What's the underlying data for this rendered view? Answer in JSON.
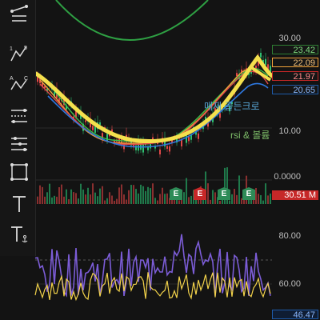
{
  "price_axis": {
    "top": "30.00",
    "mid": "10.00",
    "vol_zero": "0.0000"
  },
  "price_tags": [
    {
      "value": "23.42",
      "color": "#2e7d32",
      "text_color": "#7fdc7f"
    },
    {
      "value": "22.09",
      "color": "#f2a33a",
      "text_color": "#f2c07a"
    },
    {
      "value": "21.97",
      "color": "#c62828",
      "text_color": "#ff8a8a"
    },
    {
      "value": "20.65",
      "color": "#1e5aa8",
      "text_color": "#8ab8ff"
    }
  ],
  "volume_tag": {
    "value": "30.51 M",
    "color": "#c62828"
  },
  "indicator_axis": {
    "top": "80.00",
    "mid": "60.00",
    "last": "46.47"
  },
  "labels": {
    "golden_cross": "매재 골든크로",
    "rsi_volume": "rsi & 볼륨"
  },
  "earnings_badges": [
    "E",
    "E",
    "E",
    "E"
  ],
  "earnings_colors": [
    "#2e8b57",
    "#c62828",
    "#2e8b57",
    "#2e8b57"
  ],
  "toolbar_numbers": {
    "one": "1",
    "five": "5",
    "a": "A",
    "c": "C"
  },
  "colors": {
    "highlight": "#f4e04d",
    "ma_green": "#3bbf4a",
    "ma_orange": "#f2a33a",
    "ma_red": "#e24b4b",
    "ma_blue": "#2e78e0",
    "rsi_purple": "#7b5cd6",
    "rsi_yellow": "#f2d24a",
    "background": "#131313"
  }
}
